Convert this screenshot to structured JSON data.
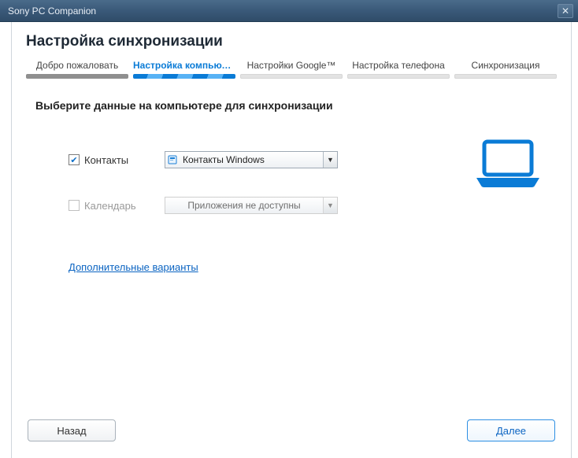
{
  "window": {
    "title": "Sony PC Companion"
  },
  "page": {
    "title": "Настройка синхронизации"
  },
  "steps": [
    {
      "label": "Добро пожаловать",
      "state": "done"
    },
    {
      "label": "Настройка компьюте...",
      "state": "active"
    },
    {
      "label": "Настройки Google™",
      "state": "future"
    },
    {
      "label": "Настройка телефона",
      "state": "future"
    },
    {
      "label": "Синхронизация",
      "state": "future"
    }
  ],
  "instruction": "Выберите данные на компьютере для синхронизации",
  "rows": {
    "contacts": {
      "label": "Контакты",
      "checked": true,
      "value": "Контакты Windows",
      "enabled": true
    },
    "calendar": {
      "label": "Календарь",
      "checked": false,
      "value": "Приложения не доступны",
      "enabled": false
    }
  },
  "moreLink": "Дополнительные варианты",
  "buttons": {
    "back": "Назад",
    "next": "Далее"
  },
  "colors": {
    "accent": "#0a7bd6",
    "link": "#0b64c2"
  }
}
